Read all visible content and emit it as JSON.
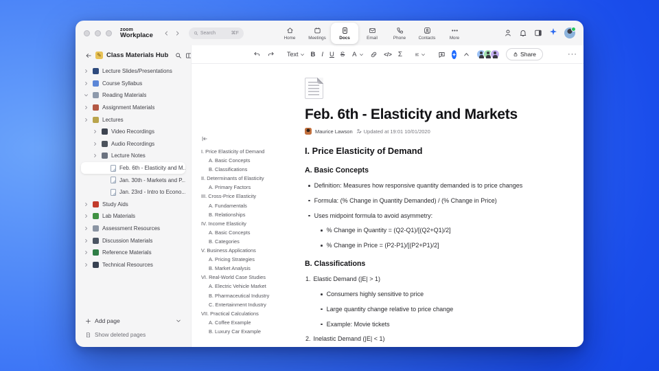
{
  "colors": {
    "accent": "#1f6bff",
    "desktop": "#2f6cf4",
    "window_bg": "#f5f5f6"
  },
  "window": {
    "logo": {
      "top": "zoom",
      "bottom": "Workplace"
    },
    "search": {
      "placeholder": "Search",
      "shortcut": "⌘F"
    },
    "nav": {
      "items": [
        {
          "label": "Home",
          "icon": "home-icon",
          "active": false
        },
        {
          "label": "Meetings",
          "icon": "calendar-icon",
          "active": false
        },
        {
          "label": "Docs",
          "icon": "doc-icon",
          "active": true
        },
        {
          "label": "Email",
          "icon": "mail-icon",
          "active": false
        },
        {
          "label": "Phone",
          "icon": "phone-icon",
          "active": false
        },
        {
          "label": "Contacts",
          "icon": "contacts-icon",
          "active": false
        },
        {
          "label": "More",
          "icon": "more-icon",
          "active": false
        }
      ]
    }
  },
  "sidebar": {
    "title": "Class Materials Hub",
    "items": [
      {
        "label": "Lecture Slides/Presentations",
        "level": 0,
        "chevron": "right",
        "icon": "slides-icon",
        "color": "#2e4a7d"
      },
      {
        "label": "Course Syllabus",
        "level": 0,
        "chevron": "right",
        "icon": "book-icon",
        "color": "#5b86d7"
      },
      {
        "label": "Reading Materials",
        "level": 0,
        "chevron": "down",
        "icon": "open-book-icon",
        "color": "#8d99ab"
      },
      {
        "label": "Assignment Materials",
        "level": 0,
        "chevron": "right",
        "icon": "backpack-icon",
        "color": "#b35844"
      },
      {
        "label": "Lectures",
        "level": 0,
        "chevron": "right",
        "icon": "lightbulb-icon",
        "color": "#b9a44c"
      },
      {
        "label": "Video Recordings",
        "level": 1,
        "chevron": "right",
        "icon": "video-camera-icon",
        "color": "#3d4450"
      },
      {
        "label": "Audio Recordings",
        "level": 1,
        "chevron": "right",
        "icon": "audio-icon",
        "color": "#4b525c"
      },
      {
        "label": "Lecture Notes",
        "level": 1,
        "chevron": "right",
        "icon": "notebook-icon",
        "color": "#6b7280"
      },
      {
        "label": "Feb. 6th - Elasticity and M...",
        "level": 2,
        "chevron": "none",
        "icon": "page-icon",
        "page": true,
        "selected": true
      },
      {
        "label": "Jan. 30th - Markets and P...",
        "level": 2,
        "chevron": "none",
        "icon": "page-icon",
        "page": true
      },
      {
        "label": "Jan. 23rd - Intro to Econo...",
        "level": 2,
        "chevron": "none",
        "icon": "page-icon",
        "page": true
      },
      {
        "label": "Study Aids",
        "level": 0,
        "chevron": "right",
        "icon": "apple-icon",
        "color": "#c23b2c"
      },
      {
        "label": "Lab Materials",
        "level": 0,
        "chevron": "right",
        "icon": "pencil-icon",
        "color": "#3f9142"
      },
      {
        "label": "Assessment Resources",
        "level": 0,
        "chevron": "right",
        "icon": "chart-icon",
        "color": "#8a94a3"
      },
      {
        "label": "Discussion Materials",
        "level": 0,
        "chevron": "right",
        "icon": "microphone-icon",
        "color": "#4b5563"
      },
      {
        "label": "Reference Materials",
        "level": 0,
        "chevron": "right",
        "icon": "books-icon",
        "color": "#2f7d46"
      },
      {
        "label": "Technical Resources",
        "level": 0,
        "chevron": "right",
        "icon": "device-icon",
        "color": "#374151"
      }
    ],
    "add_page": "Add page",
    "show_deleted": "Show deleted pages"
  },
  "toolbar": {
    "text_style": "Text",
    "bold": "B",
    "italic": "I",
    "underline": "U",
    "strike": "S",
    "color": "A",
    "code": "</>",
    "equation": "Σ",
    "share": "Share",
    "collaborators": [
      {
        "color": "#9ec3f5"
      },
      {
        "color": "#9fe0ae"
      },
      {
        "color": "#c3aef0"
      }
    ]
  },
  "outline": {
    "items": [
      {
        "label": "I. Price Elasticity of Demand",
        "level": 0
      },
      {
        "label": "A. Basic Concepts",
        "level": 1
      },
      {
        "label": "B. Classifications",
        "level": 1
      },
      {
        "label": "II. Determinants of Elasticity",
        "level": 0
      },
      {
        "label": "A. Primary Factors",
        "level": 1
      },
      {
        "label": "III. Cross-Price Elasticity",
        "level": 0
      },
      {
        "label": "A. Fundamentals",
        "level": 1
      },
      {
        "label": "B. Relationships",
        "level": 1
      },
      {
        "label": "IV. Income Elasticity",
        "level": 0
      },
      {
        "label": "A. Basic Concepts",
        "level": 1
      },
      {
        "label": "B. Categories",
        "level": 1
      },
      {
        "label": "V. Business Applications",
        "level": 0
      },
      {
        "label": "A. Pricing Strategies",
        "level": 1
      },
      {
        "label": "B. Market Analysis",
        "level": 1
      },
      {
        "label": "VI. Real-World Case Studies",
        "level": 0
      },
      {
        "label": "A. Electric Vehicle Market",
        "level": 1
      },
      {
        "label": "B. Pharmaceutical Industry",
        "level": 1
      },
      {
        "label": "C. Entertainment Industry",
        "level": 1
      },
      {
        "label": "VII. Practical Calculations",
        "level": 0
      },
      {
        "label": "A. Coffee Example",
        "level": 1
      },
      {
        "label": "B. Luxury Car Example",
        "level": 1
      }
    ]
  },
  "doc": {
    "title": "Feb. 6th - Elasticity and Markets",
    "author": "Maurice Lawson",
    "updated": "Updated at 19:01 10/01/2020",
    "blocks": [
      {
        "type": "h2",
        "text": "I. Price Elasticity of Demand"
      },
      {
        "type": "h3",
        "text": "A. Basic Concepts"
      },
      {
        "type": "li1",
        "text": "Definition: Measures how responsive quantity demanded is to price changes"
      },
      {
        "type": "li1",
        "text": "Formula: (% Change in Quantity Demanded) / (% Change in Price)"
      },
      {
        "type": "li1",
        "text": "Uses midpoint formula to avoid asymmetry:"
      },
      {
        "type": "li2",
        "text": "% Change in Quantity = (Q2-Q1)/[(Q2+Q1)/2]"
      },
      {
        "type": "li2",
        "text": "% Change in Price = (P2-P1)/[(P2+P1)/2]"
      },
      {
        "type": "h3",
        "text": "B. Classifications"
      },
      {
        "type": "ol",
        "num": "1.",
        "text": "Elastic Demand (|E| > 1)"
      },
      {
        "type": "li2",
        "text": "Consumers highly sensitive to price"
      },
      {
        "type": "li2",
        "text": "Large quantity change relative to price change"
      },
      {
        "type": "li2",
        "text": "Example: Movie tickets"
      },
      {
        "type": "ol",
        "num": "2.",
        "text": "Inelastic Demand (|E| < 1)"
      }
    ]
  }
}
